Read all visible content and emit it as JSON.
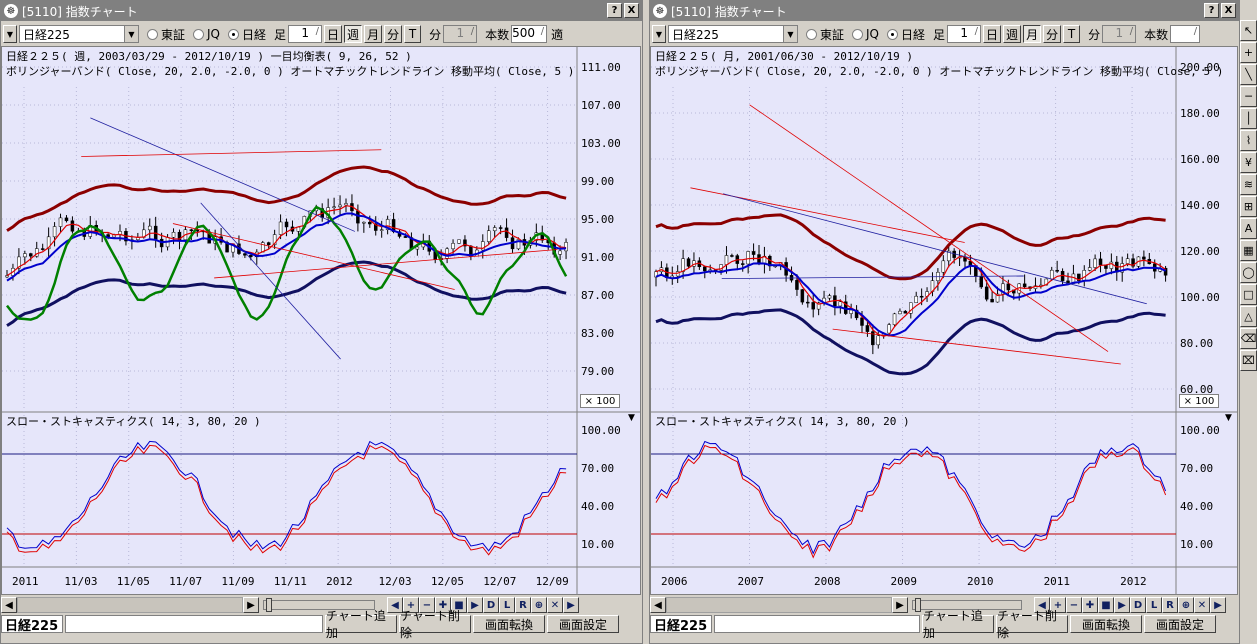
{
  "windows": [
    {
      "title": "[5110] 指数チャート",
      "title_buttons": [
        "?",
        "X"
      ],
      "symbol_value": "日経225",
      "markets": [
        {
          "label": "東証",
          "selected": false
        },
        {
          "label": "JQ",
          "selected": false
        },
        {
          "label": "日経",
          "selected": true
        }
      ],
      "ashi_label": "足",
      "ashi_value": "1",
      "periods": [
        {
          "label": "日",
          "active": false
        },
        {
          "label": "週",
          "active": true
        },
        {
          "label": "月",
          "active": false
        },
        {
          "label": "分",
          "active": false
        },
        {
          "label": "T",
          "active": false
        }
      ],
      "minute_label": "分",
      "minute_value": "1",
      "count_label": "本数",
      "count_value": "500",
      "apply_label": "適",
      "header_lines": [
        "日経２２５( 週, 2003/03/29 - 2012/10/19 )   一目均衡表( 9, 26, 52 )",
        "ボリンジャーバンド( Close, 20, 2.0, -2.0, 0 )   オートマチックトレンドライン   移動平均( Close, 5 )"
      ],
      "osc_title": "スロー・ストキャスティクス( 14, 3, 80, 20 )",
      "zoom_label": "× 100",
      "x_labels": [
        "2011",
        "11/03",
        "11/05",
        "11/07",
        "11/09",
        "11/11",
        "2012",
        "12/03",
        "12/05",
        "12/07",
        "12/09"
      ]
    },
    {
      "title": "[5110] 指数チャート",
      "title_buttons": [
        "?",
        "X"
      ],
      "symbol_value": "日経225",
      "markets": [
        {
          "label": "東証",
          "selected": false
        },
        {
          "label": "JQ",
          "selected": false
        },
        {
          "label": "日経",
          "selected": true
        }
      ],
      "ashi_label": "足",
      "ashi_value": "1",
      "periods": [
        {
          "label": "日",
          "active": false
        },
        {
          "label": "週",
          "active": false
        },
        {
          "label": "月",
          "active": true
        },
        {
          "label": "分",
          "active": false
        },
        {
          "label": "T",
          "active": false
        }
      ],
      "minute_label": "分",
      "minute_value": "1",
      "count_label": "本数",
      "count_value": "",
      "apply_label": "",
      "header_lines": [
        "日経２２５( 月, 2001/06/30 - 2012/10/19 )",
        "ボリンジャーバンド( Close, 20, 2.0, -2.0, 0 )   オートマチックトレンドライン   移動平均( Close, 5 )"
      ],
      "osc_title": "スロー・ストキャスティクス( 14, 3, 80, 20 )",
      "zoom_label": "× 100",
      "x_labels": [
        "2006",
        "2007",
        "2008",
        "2009",
        "2010",
        "2011",
        "2012"
      ]
    }
  ],
  "left_axis": [
    "111.00",
    "107.00",
    "103.00",
    "99.00",
    "95.00",
    "91.00",
    "87.00",
    "83.00",
    "79.00"
  ],
  "right_axis": [
    "200.00",
    "180.00",
    "160.00",
    "140.00",
    "120.00",
    "100.00",
    "80.00",
    "60.00"
  ],
  "osc_axis": [
    "100.00",
    "70.00",
    "40.00",
    "10.00"
  ],
  "nav_buttons": [
    "◀",
    "+",
    "−",
    "✚",
    "■",
    "▶",
    "D",
    "L",
    "R",
    "⊕",
    "✕",
    "▶"
  ],
  "status": {
    "name": "日経225",
    "buttons": [
      "チャート追加",
      "チャート削除",
      "画面転換",
      "画面設定"
    ]
  },
  "draw_tools": [
    "↖",
    "+",
    "╲",
    "─",
    "│",
    "⌇",
    "¥",
    "≋",
    "⊞",
    "A",
    "▦",
    "◯",
    "□",
    "△",
    "⌫",
    "⌧"
  ]
}
